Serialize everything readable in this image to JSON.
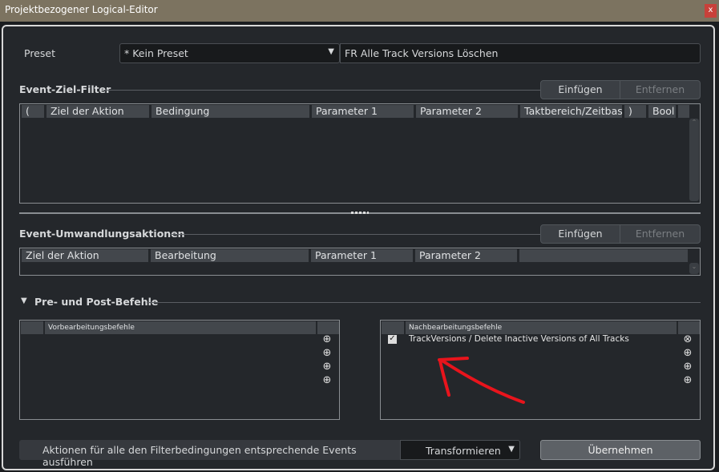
{
  "window": {
    "title": "Projektbezogener Logical-Editor",
    "close": "x"
  },
  "preset": {
    "label": "Preset",
    "value": "* Kein Preset",
    "name_field": "FR Alle Track Versions Löschen"
  },
  "filter": {
    "heading": "Event-Ziel-Filter",
    "insert": "Einfügen",
    "remove": "Entfernen",
    "columns": [
      "(",
      "Ziel der Aktion",
      "Bedingung",
      "Parameter 1",
      "Parameter 2",
      "Taktbereich/Zeitbasis",
      ")",
      "Bool"
    ]
  },
  "actions": {
    "heading": "Event-Umwandlungsaktionen",
    "insert": "Einfügen",
    "remove": "Entfernen",
    "columns": [
      "Ziel der Aktion",
      "Bearbeitung",
      "Parameter 1",
      "Parameter 2"
    ]
  },
  "prepost": {
    "heading": "Pre- und Post-Befehle",
    "pre": {
      "header": "Vorbearbeitungsbefehle"
    },
    "post": {
      "header": "Nachbearbeitungsbefehle",
      "item": "TrackVersions / Delete Inactive Versions of All Tracks",
      "checked": true
    }
  },
  "footer": {
    "label": "Aktionen für alle den Filterbedingungen entsprechende Events ausführen",
    "mode": "Transformieren",
    "apply": "Übernehmen"
  },
  "annotation": {
    "color": "#e8141c"
  }
}
